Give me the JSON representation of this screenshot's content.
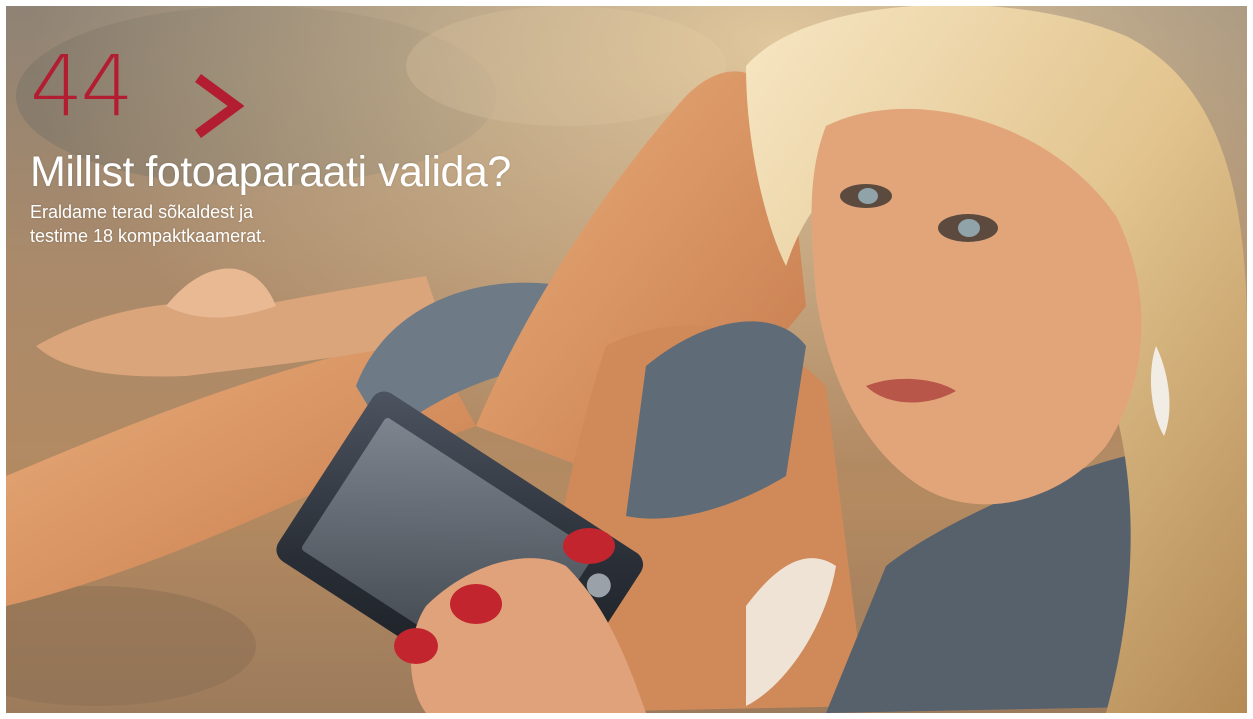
{
  "teaser": {
    "page_number": "44",
    "arrow_icon": "chevron-right-icon",
    "headline": "Millist fotoaparaati valida?",
    "subtext_lines": [
      "Eraldame terad sõkaldest ja",
      "testime 18 kompaktkaamerat."
    ]
  },
  "colors": {
    "accent": "#b21d31",
    "text": "#ffffff"
  }
}
